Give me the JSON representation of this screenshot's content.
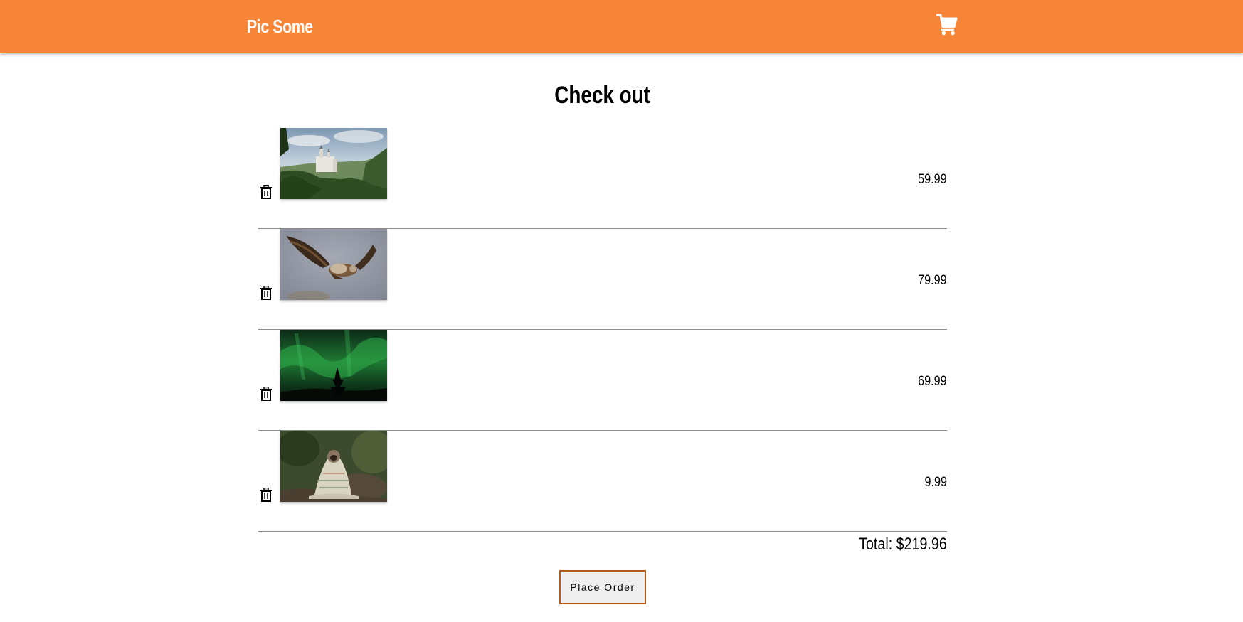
{
  "header": {
    "logo": "Pic Some",
    "cart_icon": "shopping-cart-icon",
    "background_color": "#f68537"
  },
  "page": {
    "title": "Check out"
  },
  "cart_items": [
    {
      "image_description": "castle-on-hill-photo",
      "price": "59.99",
      "remove_icon": "trash-icon"
    },
    {
      "image_description": "eagle-in-flight-photo",
      "price": "79.99",
      "remove_icon": "trash-icon"
    },
    {
      "image_description": "aurora-borealis-photo",
      "price": "69.99",
      "remove_icon": "trash-icon"
    },
    {
      "image_description": "pug-in-blanket-photo",
      "price": "9.99",
      "remove_icon": "trash-icon"
    }
  ],
  "summary": {
    "total": "Total: $219.96"
  },
  "actions": {
    "place_order_label": "Place Order",
    "button_border_color": "#b35a1f"
  }
}
